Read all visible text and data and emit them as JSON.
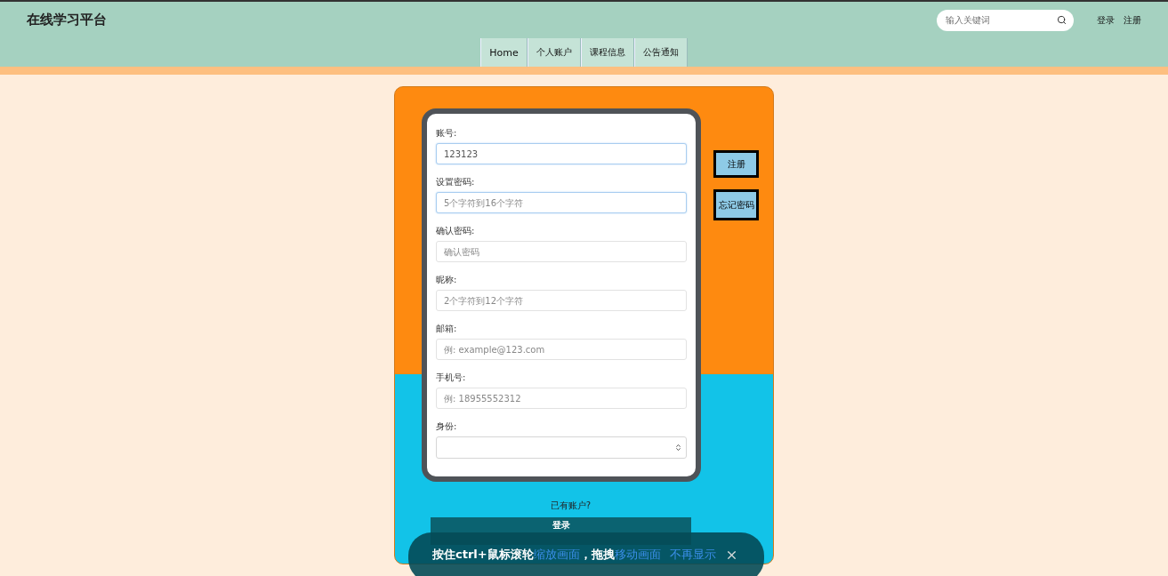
{
  "header": {
    "title": "在线学习平台",
    "search": {
      "placeholder": "输入关键词"
    },
    "links": [
      "登录",
      "注册"
    ]
  },
  "nav": {
    "tabs": [
      {
        "label": "Home"
      },
      {
        "label": "个人账户"
      },
      {
        "label": "课程信息"
      },
      {
        "label": "公告通知"
      }
    ]
  },
  "form": {
    "fields": [
      {
        "kind": "text",
        "label": "账号:",
        "value": "123123",
        "focused": true
      },
      {
        "kind": "text",
        "label": "设置密码:",
        "placeholder": "5个字符到16个字符",
        "focused": true
      },
      {
        "kind": "text",
        "label": "确认密码:",
        "placeholder": "确认密码",
        "focused": false
      },
      {
        "kind": "text",
        "label": "昵称:",
        "placeholder": "2个字符到12个字符",
        "focused": false
      },
      {
        "kind": "text",
        "label": "邮箱:",
        "placeholder": "例: example@123.com",
        "focused": false
      },
      {
        "kind": "text",
        "label": "手机号:",
        "placeholder": "例: 18955552312",
        "focused": false
      },
      {
        "kind": "select",
        "label": "身份:",
        "focused": false
      }
    ]
  },
  "side_buttons": [
    "注册",
    "忘记密码"
  ],
  "prompt": "已有账户?",
  "login_button": "登录",
  "toast": {
    "parts": [
      {
        "text": "按住ctrl+鼠标滚轮",
        "highlight": false
      },
      {
        "text": "缩放画面",
        "highlight": true
      },
      {
        "text": "，拖拽",
        "highlight": false
      },
      {
        "text": "移动画面",
        "highlight": true
      }
    ],
    "dismiss": "不再显示"
  }
}
